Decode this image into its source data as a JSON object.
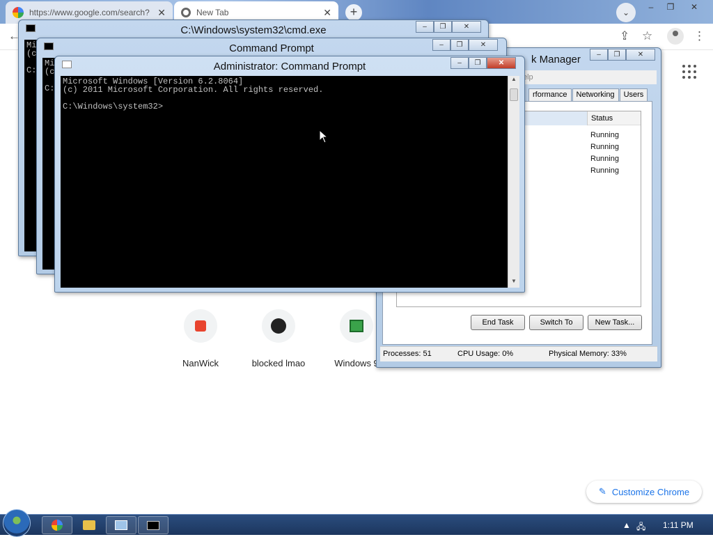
{
  "chrome": {
    "tabs": [
      {
        "label": "https://www.google.com/search?",
        "close": "✕"
      },
      {
        "label": "New Tab",
        "close": "✕"
      }
    ],
    "new_tab": "+",
    "tab_search": "⌄",
    "window_buttons": [
      "–",
      "❐",
      "✕"
    ],
    "shortcuts": [
      {
        "name": "NanWick"
      },
      {
        "name": "blocked lmao"
      },
      {
        "name": "Windows 9"
      }
    ],
    "customize_label": "Customize Chrome"
  },
  "cmd1": {
    "title": "C:\\Windows\\system32\\cmd.exe",
    "console": "Mi\n(c\n\nC:"
  },
  "cmd2": {
    "title": "Command Prompt",
    "console": "Mi\n(c\n\nC:"
  },
  "cmd3": {
    "title": "Administrator: Command Prompt",
    "console": "Microsoft Windows [Version 6.2.8064]\n(c) 2011 Microsoft Corporation. All rights reserved.\n\nC:\\Windows\\system32>"
  },
  "task_manager": {
    "title": "k Manager",
    "menu_fragment": "elp",
    "tabs": [
      "rformance",
      "Networking",
      "Users"
    ],
    "status_header": "Status",
    "rows": [
      "Running",
      "Running",
      "Running",
      "Running"
    ],
    "buttons": {
      "end_task": "End Task",
      "switch_to": "Switch To",
      "new_task": "New Task..."
    },
    "status_bar": {
      "processes": "Processes: 51",
      "cpu": "CPU Usage: 0%",
      "memory": "Physical Memory: 33%"
    }
  },
  "taskbar": {
    "clock": "1:11 PM"
  }
}
